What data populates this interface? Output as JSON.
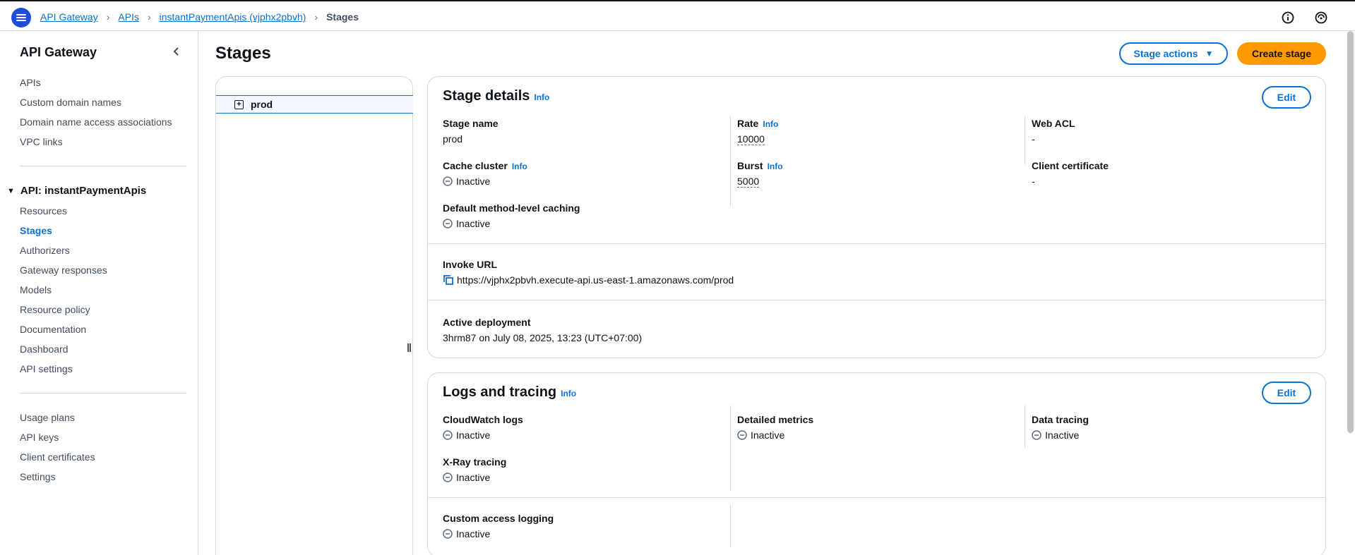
{
  "breadcrumb": {
    "items": [
      "API Gateway",
      "APIs",
      "instantPaymentApis (vjphx2pbvh)"
    ],
    "current": "Stages"
  },
  "sidebar": {
    "title": "API Gateway",
    "top_items": [
      "APIs",
      "Custom domain names",
      "Domain name access associations",
      "VPC links"
    ],
    "api_header": "API: instantPaymentApis",
    "api_items": [
      "Resources",
      "Stages",
      "Authorizers",
      "Gateway responses",
      "Models",
      "Resource policy",
      "Documentation",
      "Dashboard",
      "API settings"
    ],
    "bottom_items": [
      "Usage plans",
      "API keys",
      "Client certificates",
      "Settings"
    ]
  },
  "main": {
    "title": "Stages",
    "stage_actions_label": "Stage actions",
    "create_stage_label": "Create stage",
    "tree": {
      "node": "prod"
    }
  },
  "stage_details": {
    "title": "Stage details",
    "info": "Info",
    "edit": "Edit",
    "stage_name_label": "Stage name",
    "stage_name": "prod",
    "rate_label": "Rate",
    "rate": "10000",
    "web_acl_label": "Web ACL",
    "web_acl": "-",
    "cache_cluster_label": "Cache cluster",
    "cache_cluster": "Inactive",
    "burst_label": "Burst",
    "burst": "5000",
    "client_cert_label": "Client certificate",
    "client_cert": "-",
    "default_caching_label": "Default method-level caching",
    "default_caching": "Inactive",
    "invoke_url_label": "Invoke URL",
    "invoke_url": "https://vjphx2pbvh.execute-api.us-east-1.amazonaws.com/prod",
    "active_deployment_label": "Active deployment",
    "active_deployment": "3hrm87 on July 08, 2025, 13:23 (UTC+07:00)"
  },
  "logs": {
    "title": "Logs and tracing",
    "info": "Info",
    "edit": "Edit",
    "cloudwatch_label": "CloudWatch logs",
    "cloudwatch": "Inactive",
    "detailed_metrics_label": "Detailed metrics",
    "detailed_metrics": "Inactive",
    "data_tracing_label": "Data tracing",
    "data_tracing": "Inactive",
    "xray_label": "X-Ray tracing",
    "xray": "Inactive",
    "custom_access_label": "Custom access logging",
    "custom_access": "Inactive"
  },
  "colors": {
    "accent": "#0972d3",
    "primary_button": "#ff9900",
    "text": "#0f141a",
    "muted": "#5f6b7a",
    "border": "#d5dbdb"
  }
}
